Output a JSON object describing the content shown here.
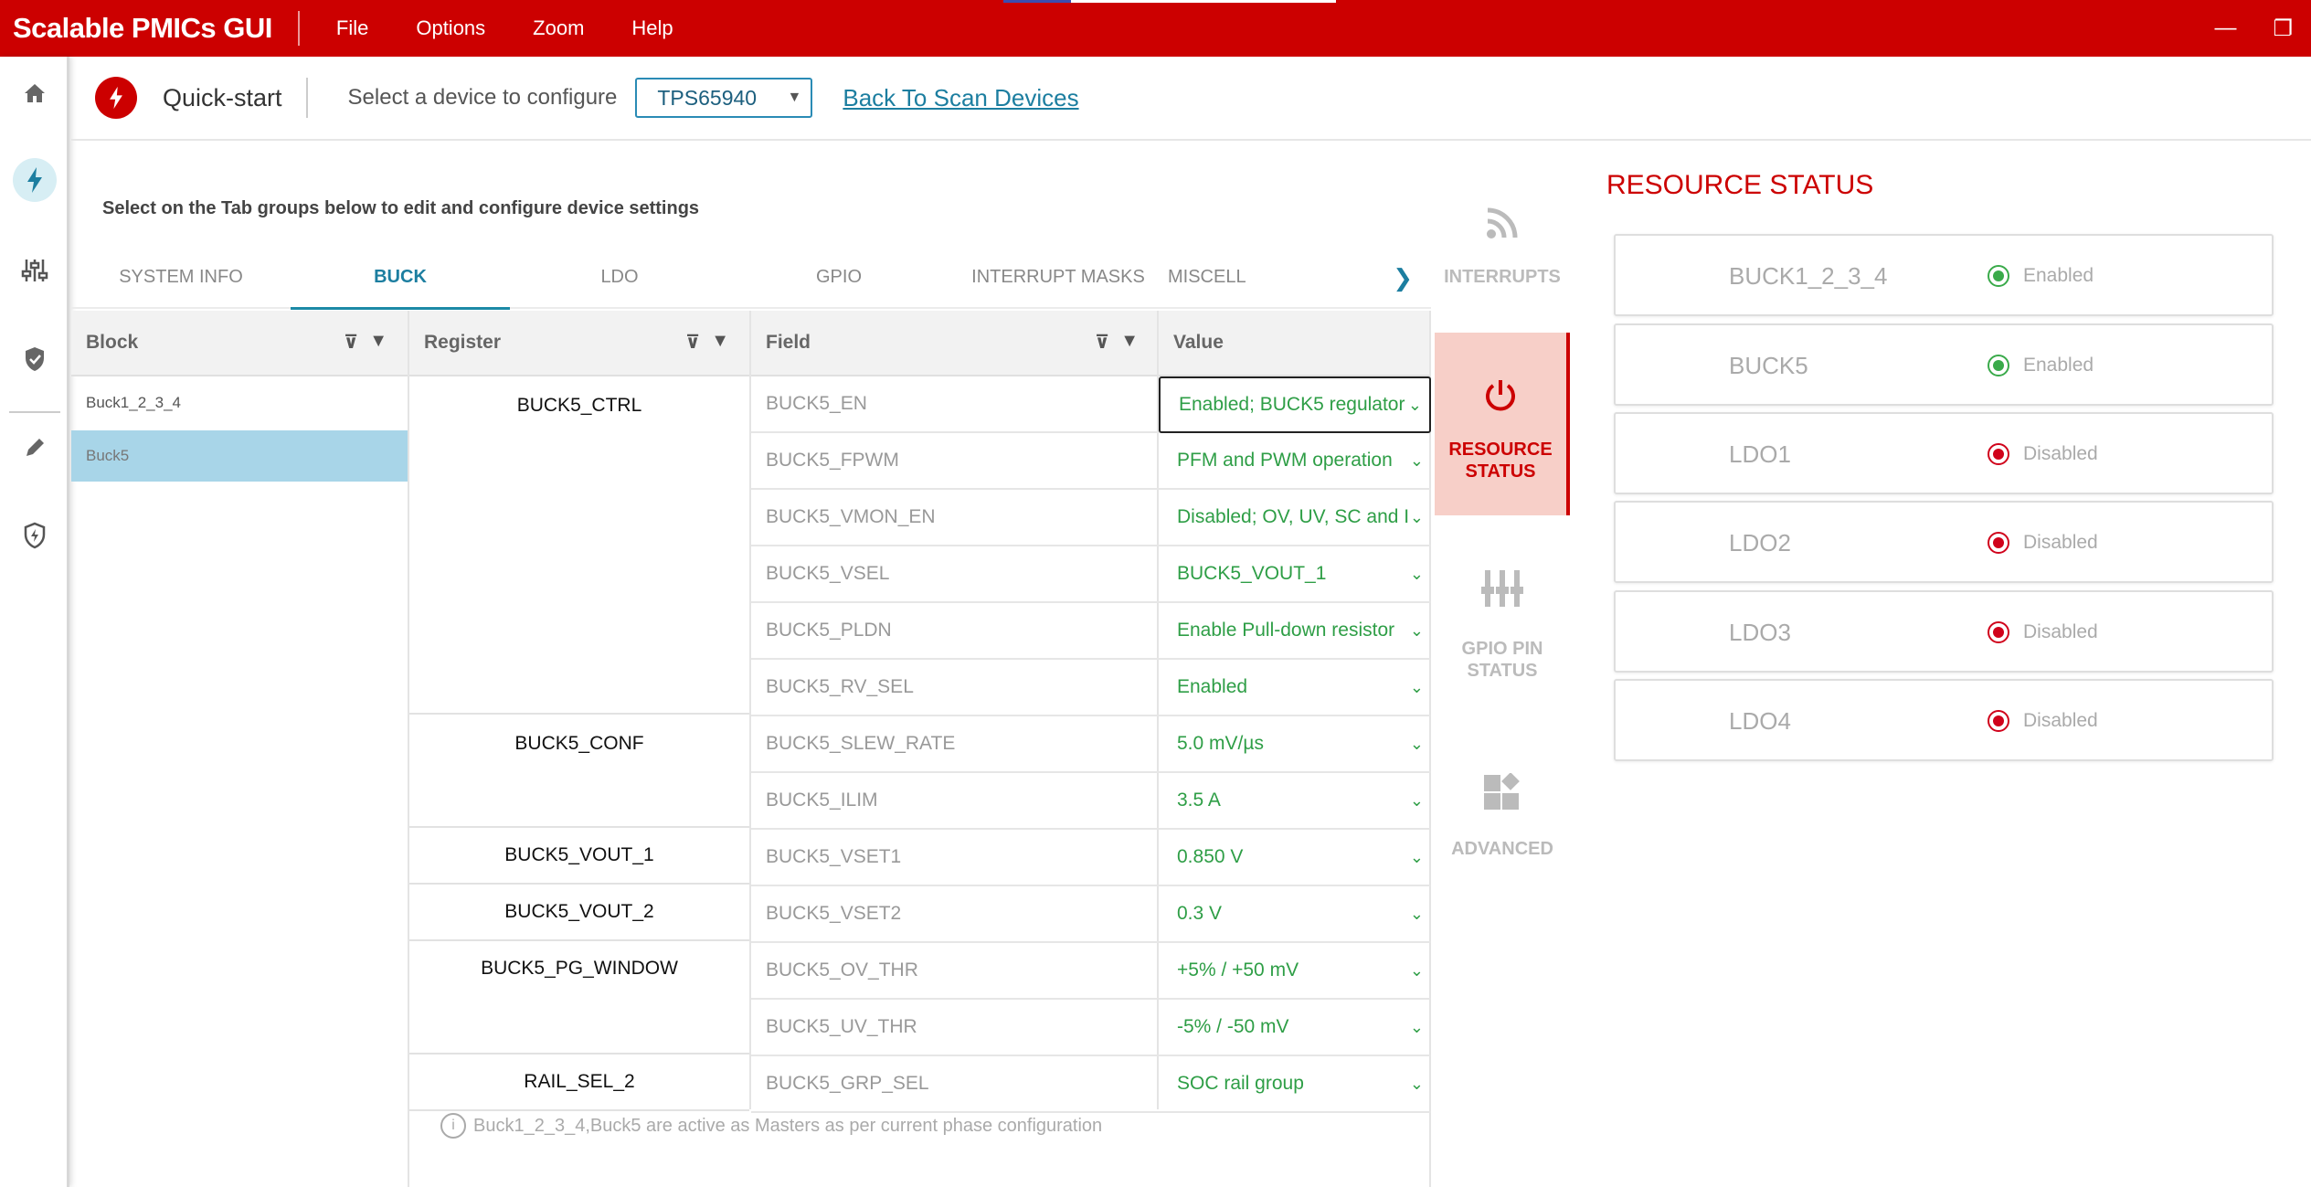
{
  "app": {
    "title": "Scalable PMICs GUI",
    "menu": [
      "File",
      "Options",
      "Zoom",
      "Help"
    ]
  },
  "window": {
    "minimize": "—",
    "restore": "❐"
  },
  "header": {
    "quickstart": "Quick-start",
    "select_label": "Select a device to configure",
    "device": "TPS65940",
    "back_link": "Back To Scan Devices"
  },
  "instruction": "Select on the Tab groups below to edit and configure device settings",
  "tabs": [
    "SYSTEM INFO",
    "BUCK",
    "LDO",
    "GPIO",
    "INTERRUPT MASKS",
    "MISCELL"
  ],
  "columns": {
    "block": "Block",
    "register": "Register",
    "field": "Field",
    "value": "Value"
  },
  "blocks": [
    "Buck1_2_3_4",
    "Buck5"
  ],
  "registers": [
    "BUCK5_CTRL",
    "BUCK5_CONF",
    "BUCK5_VOUT_1",
    "BUCK5_VOUT_2",
    "BUCK5_PG_WINDOW",
    "RAIL_SEL_2"
  ],
  "rows": [
    {
      "field": "BUCK5_EN",
      "value": "Enabled; BUCK5 regulator"
    },
    {
      "field": "BUCK5_FPWM",
      "value": "PFM and PWM operation"
    },
    {
      "field": "BUCK5_VMON_EN",
      "value": "Disabled; OV, UV, SC and I"
    },
    {
      "field": "BUCK5_VSEL",
      "value": "BUCK5_VOUT_1"
    },
    {
      "field": "BUCK5_PLDN",
      "value": "Enable Pull-down resistor"
    },
    {
      "field": "BUCK5_RV_SEL",
      "value": "Enabled"
    },
    {
      "field": "BUCK5_SLEW_RATE",
      "value": "5.0 mV/µs"
    },
    {
      "field": "BUCK5_ILIM",
      "value": "3.5 A"
    },
    {
      "field": "BUCK5_VSET1",
      "value": "0.850 V"
    },
    {
      "field": "BUCK5_VSET2",
      "value": "0.3 V"
    },
    {
      "field": "BUCK5_OV_THR",
      "value": "+5% / +50 mV"
    },
    {
      "field": "BUCK5_UV_THR",
      "value": "-5% / -50 mV"
    },
    {
      "field": "BUCK5_GRP_SEL",
      "value": "SOC rail group"
    }
  ],
  "note": "Buck1_2_3_4,Buck5 are active as Masters as per current phase configuration",
  "side_tabs": [
    "INTERRUPTS",
    "RESOURCE STATUS",
    "GPIO PIN STATUS",
    "ADVANCED"
  ],
  "resource_status": {
    "title": "RESOURCE STATUS",
    "items": [
      {
        "name": "BUCK1_2_3_4",
        "state": "Enabled"
      },
      {
        "name": "BUCK5",
        "state": "Enabled"
      },
      {
        "name": "LDO1",
        "state": "Disabled"
      },
      {
        "name": "LDO2",
        "state": "Disabled"
      },
      {
        "name": "LDO3",
        "state": "Disabled"
      },
      {
        "name": "LDO4",
        "state": "Disabled"
      }
    ]
  },
  "colors": {
    "brand": "#cc0000",
    "enabled": "#3aaa4a",
    "disabled": "#d0021b",
    "value_text": "#2e9e46",
    "accent": "#1c7ea0"
  }
}
